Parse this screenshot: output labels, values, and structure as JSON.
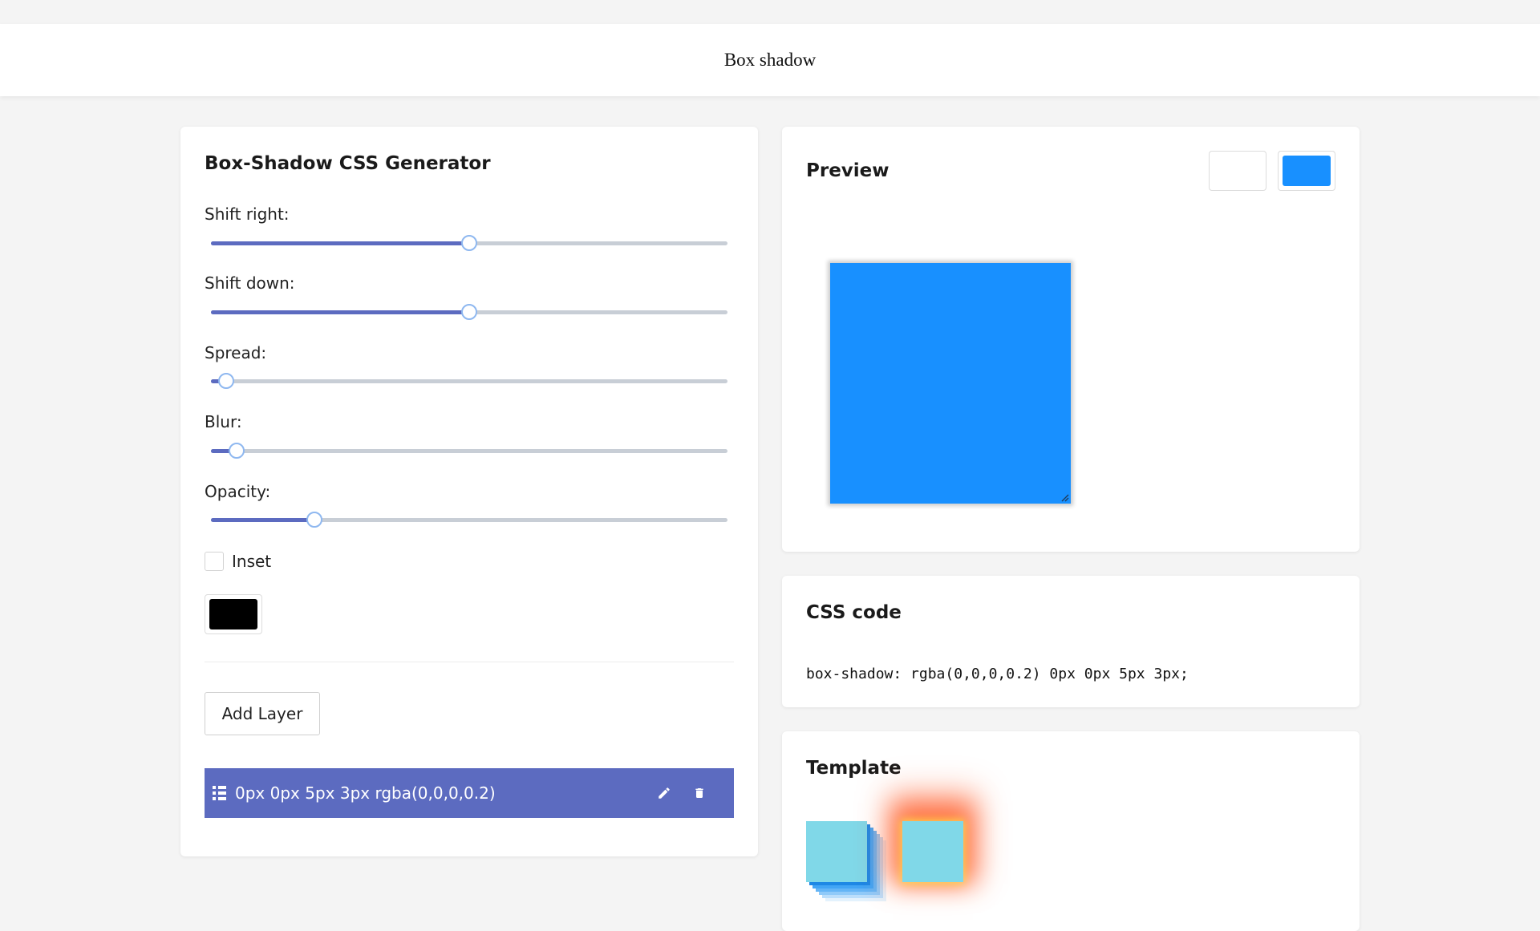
{
  "header": {
    "title": "Box shadow"
  },
  "generator": {
    "title": "Box-Shadow CSS Generator",
    "sliders": [
      {
        "label": "Shift right:",
        "value_fraction": 0.5
      },
      {
        "label": "Shift down:",
        "value_fraction": 0.5
      },
      {
        "label": "Spread:",
        "value_fraction": 0.03
      },
      {
        "label": "Blur:",
        "value_fraction": 0.05
      },
      {
        "label": "Opacity:",
        "value_fraction": 0.2
      }
    ],
    "inset_label": "Inset",
    "inset_checked": false,
    "shadow_color": "#000000",
    "add_layer_label": "Add Layer",
    "layers": [
      {
        "text": "0px 0px 5px 3px rgba(0,0,0,0.2)"
      }
    ]
  },
  "preview": {
    "title": "Preview",
    "background_options": [
      "#ffffff",
      "#1890ff"
    ],
    "box_color": "#1890ff"
  },
  "code": {
    "title": "CSS code",
    "text": "box-shadow: rgba(0,0,0,0.2) 0px 0px 5px 3px;"
  },
  "template": {
    "title": "Template"
  },
  "colors": {
    "accent": "#5c6bc0",
    "track": "#c8ced6",
    "thumb_border": "#8fb8f0"
  },
  "icons": [
    "list-icon",
    "edit-icon",
    "delete-icon",
    "resize-grip-icon"
  ]
}
